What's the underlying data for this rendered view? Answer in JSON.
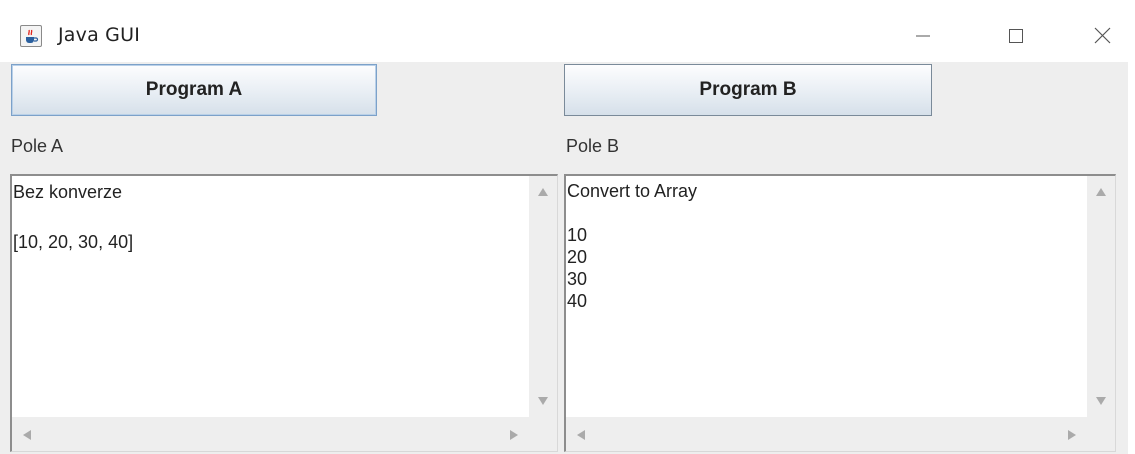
{
  "window": {
    "title": "Java GUI"
  },
  "buttons": {
    "program_a": "Program A",
    "program_b": "Program B"
  },
  "labels": {
    "pole_a": "Pole A",
    "pole_b": "Pole B"
  },
  "text_areas": {
    "a": "Bez konverze\n\n[10, 20, 30, 40]",
    "b": "Convert to Array\n\n10\n20\n30\n40"
  },
  "icons": {
    "app": "java-coffee-cup-icon",
    "minimize": "minimize-icon",
    "maximize": "maximize-icon",
    "close": "close-icon"
  }
}
